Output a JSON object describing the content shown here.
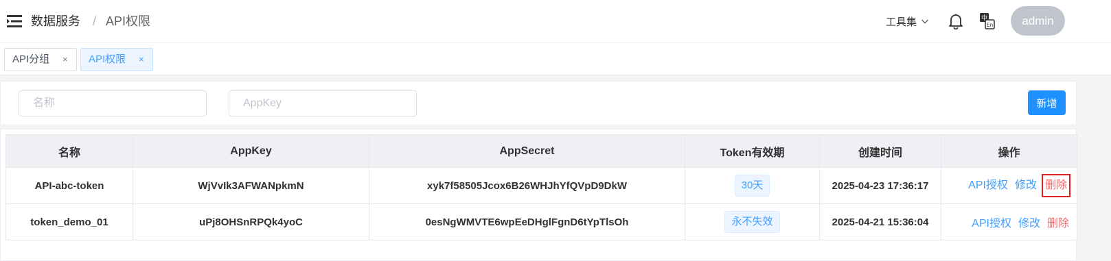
{
  "breadcrumb": {
    "root": "数据服务",
    "separator": "/",
    "current": "API权限"
  },
  "header": {
    "tools_label": "工具集",
    "avatar_label": "admin",
    "icons": [
      "menu-icon",
      "bell-icon",
      "language-icon",
      "chevron-down-icon"
    ]
  },
  "tabs": [
    {
      "label": "API分组",
      "close": "×",
      "active": false
    },
    {
      "label": "API权限",
      "close": "×",
      "active": true
    }
  ],
  "search": {
    "name_placeholder": "名称",
    "appkey_placeholder": "AppKey",
    "add_label": "新增"
  },
  "table": {
    "columns": [
      "名称",
      "AppKey",
      "AppSecret",
      "Token有效期",
      "创建时间",
      "操作"
    ],
    "rows": [
      {
        "name": "API-abc-token",
        "appkey": "WjVvIk3AFWANpkmN",
        "appsecret": "xyk7f58505Jcox6B26WHJhYfQVpD9DkW",
        "token_validity": "30天",
        "created": "2025-04-23 17:36:17",
        "actions": {
          "grant": "API授权",
          "edit": "修改",
          "delete": "删除"
        }
      },
      {
        "name": "token_demo_01",
        "appkey": "uPj8OHSnRPQk4yoC",
        "appsecret": "0esNgWMVTE6wpEeDHglFgnD6tYpTlsOh",
        "token_validity": "永不失效",
        "created": "2025-04-21 15:36:04",
        "actions": {
          "grant": "API授权",
          "edit": "修改",
          "delete": "删除"
        }
      }
    ]
  },
  "colors": {
    "primary": "#1e90ff",
    "link": "#409eff",
    "danger": "#f56c6c",
    "highlight_box": "#e02020"
  }
}
